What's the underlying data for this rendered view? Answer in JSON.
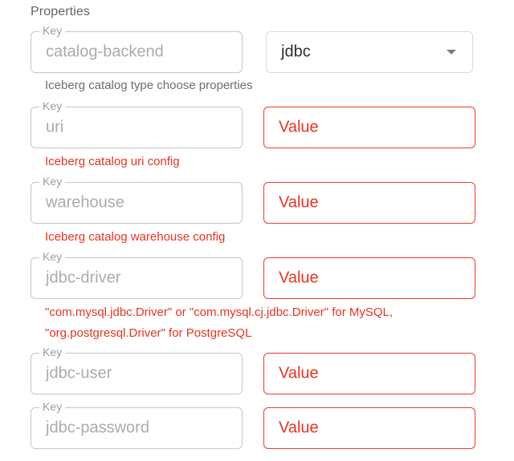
{
  "section_title": "Properties",
  "key_legend": "Key",
  "rows": [
    {
      "key": "catalog-backend",
      "select_value": "jdbc",
      "helper": "Iceberg catalog type choose properties"
    },
    {
      "key": "uri",
      "value": "Value",
      "helper": "Iceberg catalog uri config"
    },
    {
      "key": "warehouse",
      "value": "Value",
      "helper": "Iceberg catalog warehouse config"
    },
    {
      "key": "jdbc-driver",
      "value": "Value",
      "helper_line1": "\"com.mysql.jdbc.Driver\" or \"com.mysql.cj.jdbc.Driver\" for MySQL,",
      "helper_line2": "\"org.postgresql.Driver\" for PostgreSQL"
    },
    {
      "key": "jdbc-user",
      "value": "Value"
    },
    {
      "key": "jdbc-password",
      "value": "Value"
    }
  ],
  "colors": {
    "error": "#e53423",
    "key_border": "#c4c6c9",
    "value_border": "#ef3a2c"
  },
  "icons": {
    "select_caret": "chevron-down-icon"
  }
}
